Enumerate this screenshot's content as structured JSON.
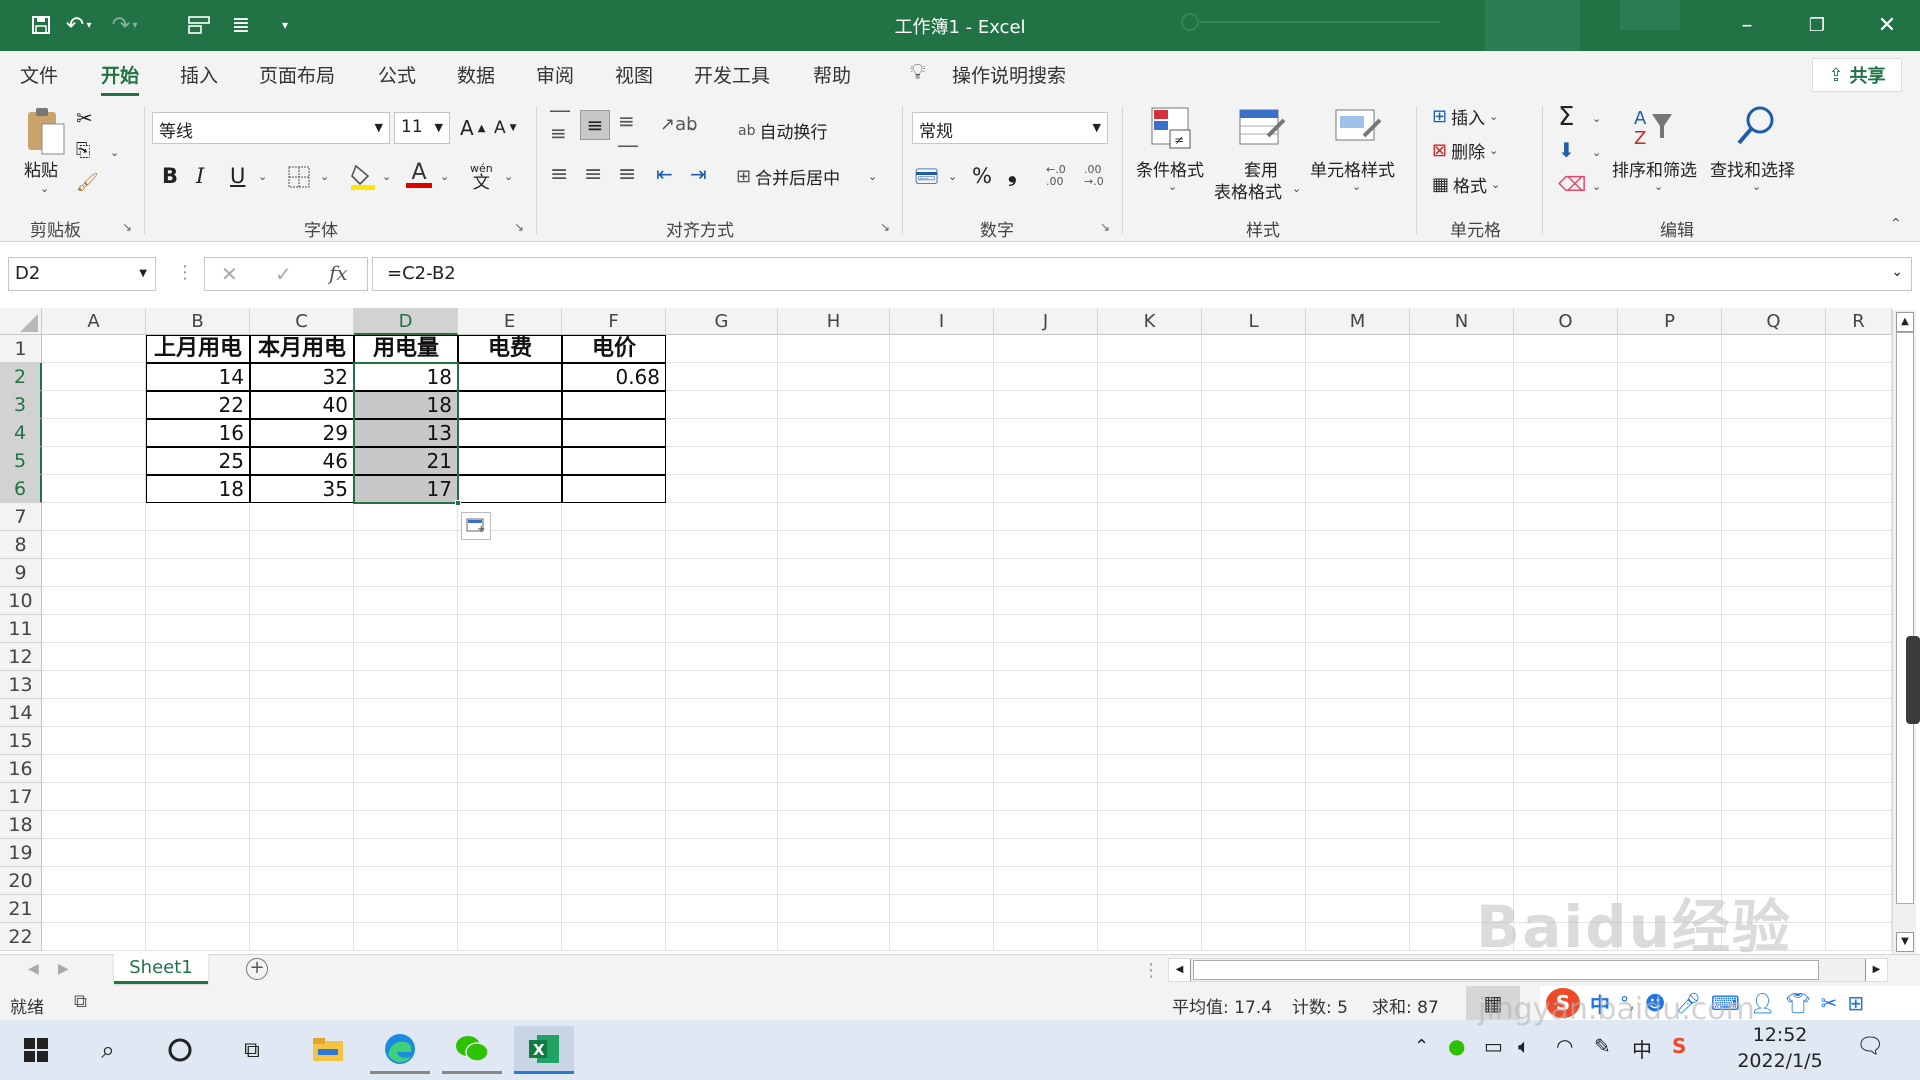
{
  "window": {
    "title": "工作簿1  -  Excel"
  },
  "tabs": [
    "文件",
    "开始",
    "插入",
    "页面布局",
    "公式",
    "数据",
    "审阅",
    "视图",
    "开发工具",
    "帮助"
  ],
  "tell_me": "操作说明搜索",
  "share_label": "共享",
  "ribbon": {
    "clipboard": {
      "paste": "粘贴",
      "group": "剪贴板"
    },
    "font": {
      "name": "等线",
      "size": "11",
      "bold": "B",
      "italic": "I",
      "underline": "U",
      "group": "字体",
      "grow": "A",
      "shrink": "A",
      "phonetic_top": "wén",
      "phonetic_bottom": "文"
    },
    "alignment": {
      "wrap": "自动换行",
      "merge": "合并后居中",
      "group": "对齐方式",
      "wrap_icon": "ab"
    },
    "number": {
      "format": "常规",
      "percent": "%",
      "comma": "❟",
      "inc_decimal": ".00",
      "dec_decimal": ".00",
      "group": "数字"
    },
    "styles": {
      "conditional": "条件格式",
      "table_format_1": "套用",
      "table_format_2": "表格格式",
      "cell_styles": "单元格样式",
      "group": "样式"
    },
    "cells": {
      "insert": "插入",
      "delete": "删除",
      "format": "格式",
      "group": "单元格"
    },
    "editing": {
      "sort": "排序和筛选",
      "find": "查找和选择",
      "group": "编辑",
      "sum": "Σ"
    }
  },
  "formula_bar": {
    "name_box": "D2",
    "formula": "=C2-B2",
    "fx": "fx"
  },
  "columns": [
    "A",
    "B",
    "C",
    "D",
    "E",
    "F",
    "G",
    "H",
    "I",
    "J",
    "K",
    "L",
    "M",
    "N",
    "O",
    "P",
    "Q",
    "R"
  ],
  "rows": [
    "1",
    "2",
    "3",
    "4",
    "5",
    "6",
    "7",
    "8",
    "9",
    "10",
    "11",
    "12",
    "13",
    "14",
    "15",
    "16",
    "17",
    "18",
    "19",
    "20",
    "21",
    "22"
  ],
  "table": {
    "headers": {
      "B": "上月用电",
      "C": "本月用电",
      "D": "用电量",
      "E": "电费",
      "F": "电价"
    },
    "data": [
      {
        "B": "14",
        "C": "32",
        "D": "18",
        "E": "",
        "F": "0.68"
      },
      {
        "B": "22",
        "C": "40",
        "D": "18",
        "E": "",
        "F": ""
      },
      {
        "B": "16",
        "C": "29",
        "D": "13",
        "E": "",
        "F": ""
      },
      {
        "B": "25",
        "C": "46",
        "D": "21",
        "E": "",
        "F": ""
      },
      {
        "B": "18",
        "C": "35",
        "D": "17",
        "E": "",
        "F": ""
      }
    ]
  },
  "sheet_tab": "Sheet1",
  "status": {
    "ready": "就绪",
    "average": "平均值: 17.4",
    "count": "计数: 5",
    "sum": "求和: 87"
  },
  "taskbar": {
    "time": "12:52",
    "date": "2022/1/5",
    "ime": "中"
  },
  "watermark": {
    "line1": "Baidu经验",
    "line2": "jingyan.baidu.com"
  },
  "colors": {
    "excel_green": "#217346",
    "selection": "#c8c8c8",
    "watermark": "#cfcfcf"
  }
}
